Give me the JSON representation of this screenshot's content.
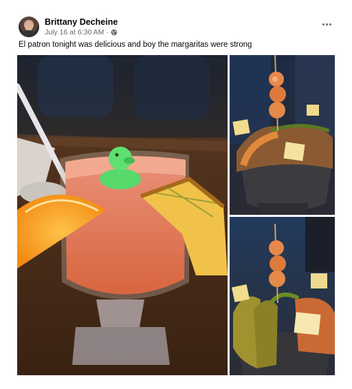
{
  "post": {
    "author": "Brittany Decheine",
    "timestamp": "July 16 at 6:30 AM",
    "separator": "·",
    "privacy_icon": "globe-icon",
    "more_icon": "more-horizontal-icon",
    "caption": "El patron tonight was delicious and boy the margaritas were strong"
  },
  "photos": [
    {
      "subject": "margarita-with-rubber-duck-and-fruit"
    },
    {
      "subject": "molcajete-skewer-top"
    },
    {
      "subject": "molcajete-skewer-bottom"
    }
  ],
  "colors": {
    "author_text": "#050505",
    "meta_text": "#65676b",
    "background": "#ffffff"
  }
}
